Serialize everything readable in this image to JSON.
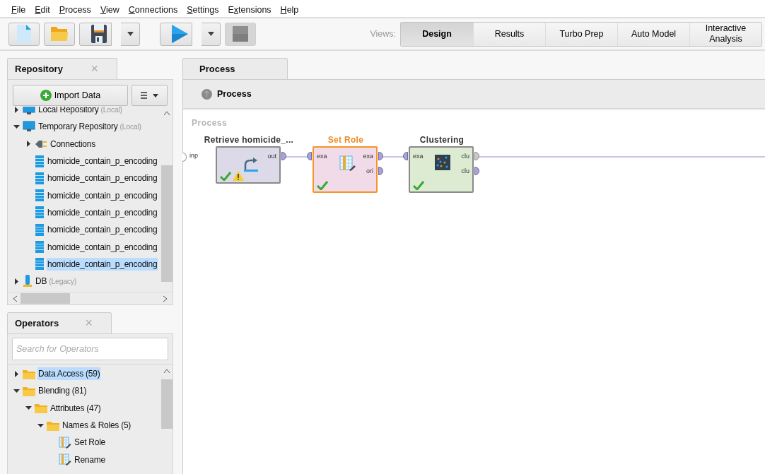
{
  "menu": [
    {
      "key": "F",
      "rest": "ile"
    },
    {
      "key": "E",
      "rest": "dit"
    },
    {
      "key": "P",
      "rest": "rocess"
    },
    {
      "key": "V",
      "rest": "iew"
    },
    {
      "key": "C",
      "rest": "onnections"
    },
    {
      "key": "S",
      "rest": "ettings"
    },
    {
      "lead": "E",
      "key": "x",
      "rest": "tensions"
    },
    {
      "key": "H",
      "rest": "elp"
    }
  ],
  "toolbar": [
    {
      "kind": "new"
    },
    {
      "kind": "open"
    },
    {
      "kind": "save"
    },
    {
      "kind": "run"
    },
    {
      "kind": "stop",
      "disabled": true
    }
  ],
  "views": {
    "label": "Views:",
    "tabs": [
      {
        "label": "Design",
        "selected": true
      },
      {
        "label": "Results",
        "selected": false
      },
      {
        "label": "Turbo Prep",
        "selected": false
      },
      {
        "label": "Auto Model",
        "selected": false
      },
      {
        "label": "Interactive Analysis",
        "selected": false
      }
    ]
  },
  "repository": {
    "title": "Repository",
    "close": "×",
    "import_button": "Import Data",
    "tree": [
      {
        "label": "Local Repository",
        "note": "(Local)",
        "kind": "repo",
        "expanded": false,
        "selected": false
      },
      {
        "label": "Temporary Repository",
        "note": "(Local)",
        "kind": "repo",
        "expanded": true,
        "selected": false,
        "children": [
          {
            "label": "Connections",
            "kind": "connections",
            "expanded": false,
            "selected": false
          },
          {
            "label": "homicide_contain_p_encoding",
            "kind": "data",
            "selected": false
          },
          {
            "label": "homicide_contain_p_encoding",
            "kind": "data",
            "selected": false
          },
          {
            "label": "homicide_contain_p_encoding",
            "kind": "data",
            "selected": false
          },
          {
            "label": "homicide_contain_p_encoding",
            "kind": "data",
            "selected": false
          },
          {
            "label": "homicide_contain_p_encoding",
            "kind": "data",
            "selected": false
          },
          {
            "label": "homicide_contain_p_encoding",
            "kind": "data",
            "selected": false
          },
          {
            "label": "homicide_contain_p_encoding",
            "kind": "data",
            "selected": true
          }
        ]
      },
      {
        "label": "DB",
        "note": "(Legacy)",
        "kind": "db",
        "expanded": false,
        "selected": false
      }
    ]
  },
  "operators": {
    "title": "Operators",
    "close": "×",
    "search": {
      "placeholder": "Search for Operators"
    },
    "tree": [
      {
        "label": "Data Access (59)",
        "kind": "folder",
        "expanded": false,
        "selected": true
      },
      {
        "label": "Blending (81)",
        "kind": "folder",
        "expanded": true,
        "selected": false,
        "children": [
          {
            "label": "Attributes (47)",
            "kind": "folder",
            "expanded": true,
            "selected": false,
            "children": [
              {
                "label": "Names & Roles (5)",
                "kind": "folder",
                "expanded": true,
                "selected": false,
                "children": [
                  {
                    "label": "Set Role",
                    "kind": "operator",
                    "selected": false
                  },
                  {
                    "label": "Rename",
                    "kind": "operator",
                    "selected": false
                  }
                ]
              }
            ]
          }
        ]
      }
    ]
  },
  "process": {
    "tab": "Process",
    "breadcrumb": "Process",
    "canvas_label": "Process",
    "input_port": "inp",
    "nodes": [
      {
        "title": "Retrieve homicide_...",
        "kind": "retrieve",
        "selected": false,
        "ok": true,
        "warning": true,
        "outputs": [
          "out"
        ]
      },
      {
        "title": "Set Role",
        "kind": "set_role",
        "selected": true,
        "ok": true,
        "warning": false,
        "inputs": [
          "exa"
        ],
        "outputs": [
          "exa",
          "ori"
        ]
      },
      {
        "title": "Clustering",
        "kind": "clustering",
        "selected": false,
        "ok": true,
        "warning": false,
        "inputs": [
          "exa"
        ],
        "outputs": [
          "clu",
          "clu"
        ]
      }
    ]
  }
}
